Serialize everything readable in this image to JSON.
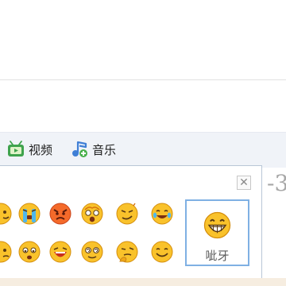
{
  "toolbar": {
    "video": {
      "label": "视频",
      "icon": "tv-video-icon"
    },
    "music": {
      "label": "音乐",
      "icon": "music-note-icon"
    }
  },
  "side_number": "-3",
  "emoji_panel": {
    "close_glyph": "✕",
    "emojis": [
      {
        "name": "emoji-cry"
      },
      {
        "name": "emoji-angry"
      },
      {
        "name": "emoji-shocked"
      },
      {
        "name": "emoji-smirk"
      },
      {
        "name": "emoji-tearful-laugh"
      },
      {
        "name": "emoji-pout"
      },
      {
        "name": "emoji-sad-face"
      },
      {
        "name": "emoji-laugh-cry"
      },
      {
        "name": "emoji-dizzy"
      },
      {
        "name": "emoji-thinking"
      },
      {
        "name": "emoji-smile"
      }
    ],
    "preview": {
      "label": "呲牙",
      "icon": "grin-teeth-icon"
    }
  }
}
